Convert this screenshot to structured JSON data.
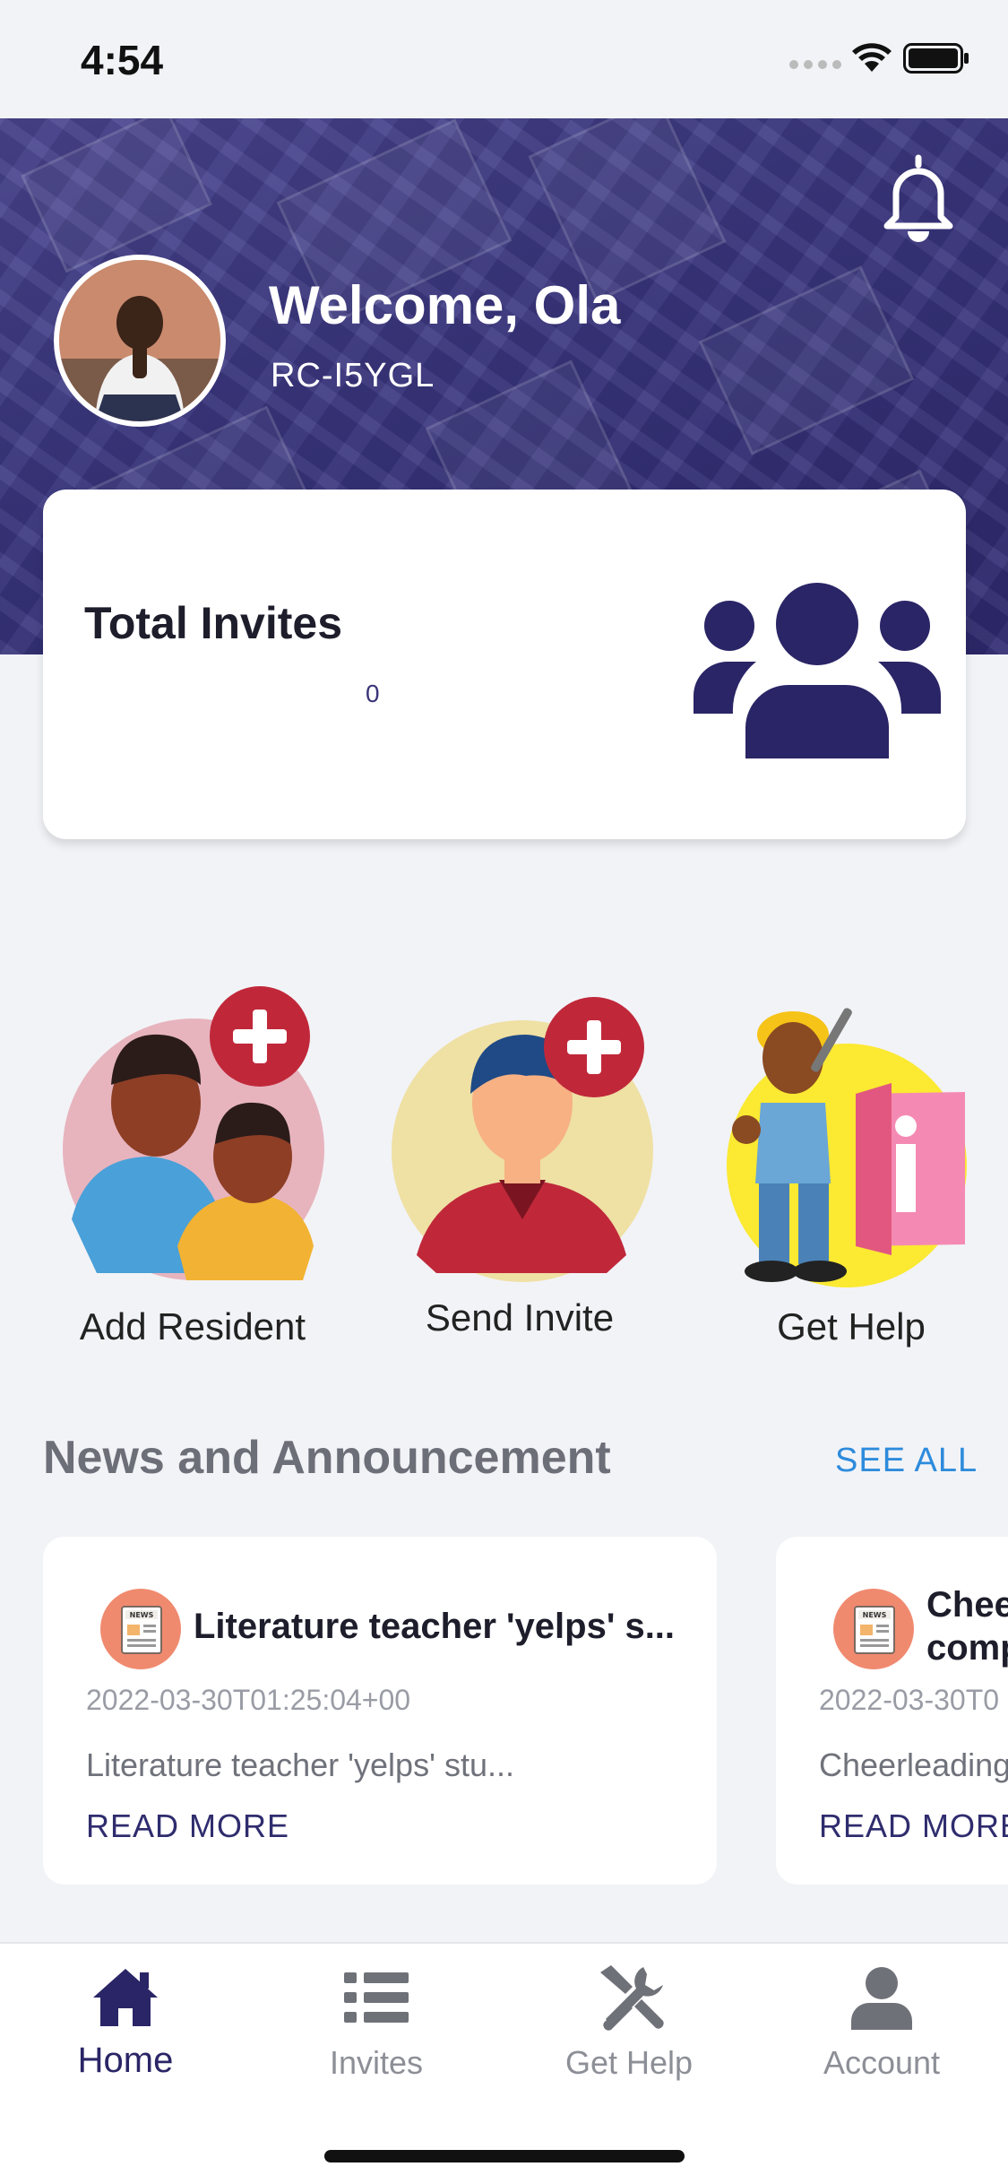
{
  "status_bar": {
    "time": "4:54"
  },
  "header": {
    "welcome": "Welcome, Ola",
    "code": "RC-I5YGL"
  },
  "invites_card": {
    "title": "Total Invites",
    "value": "0"
  },
  "actions": [
    {
      "label": "Add Resident"
    },
    {
      "label": "Send Invite"
    },
    {
      "label": "Get Help"
    }
  ],
  "news": {
    "heading": "News and Announcement",
    "see_all": "SEE ALL",
    "items": [
      {
        "title": "Literature teacher 'yelps' s...",
        "date": "2022-03-30T01:25:04+00",
        "excerpt": "Literature teacher 'yelps' stu...",
        "read_more": "READ MORE",
        "icon_text": "NEWS"
      },
      {
        "title_line1": "Chee",
        "title_line2": "comp",
        "date": "2022-03-30T0",
        "excerpt": "Cheerleading",
        "read_more": "READ MORE",
        "icon_text": "NEWS"
      }
    ]
  },
  "tabbar": {
    "tabs": [
      {
        "label": "Home",
        "icon": "home-icon",
        "active": true
      },
      {
        "label": "Invites",
        "icon": "list-icon",
        "active": false
      },
      {
        "label": "Get Help",
        "icon": "tools-icon",
        "active": false
      },
      {
        "label": "Account",
        "icon": "user-icon",
        "active": false
      }
    ]
  },
  "colors": {
    "brand": "#2f2c6e",
    "link": "#2d8bdc",
    "tab_inactive": "#8d8f97",
    "news_icon_bg": "#f08a6f"
  }
}
